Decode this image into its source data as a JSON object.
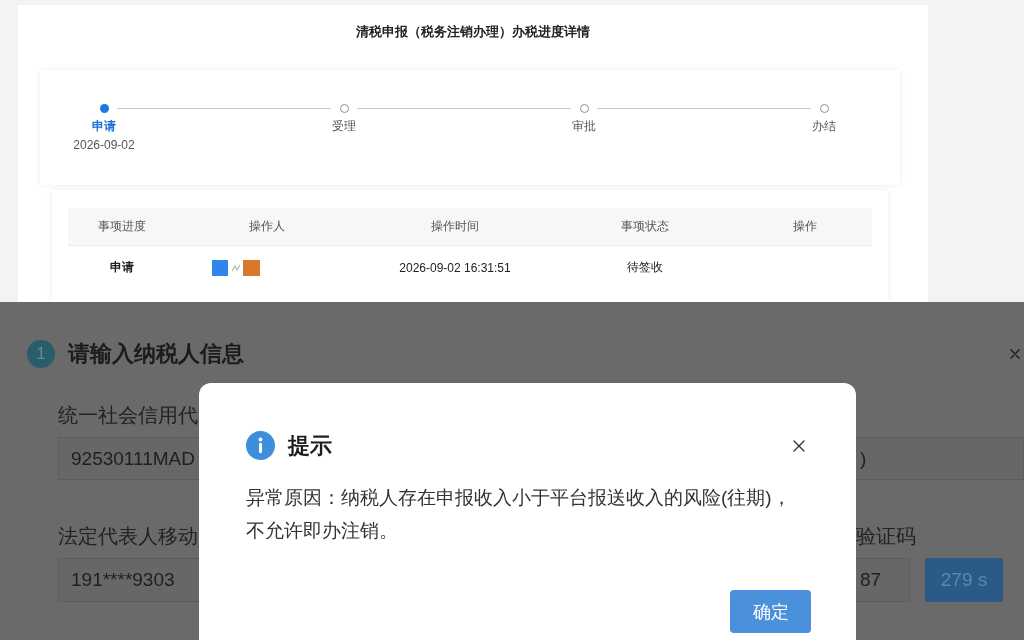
{
  "progress_page": {
    "title": "清税申报（税务注销办理）办税进度详情",
    "steps": [
      {
        "label": "申请",
        "date": "2026-09-02",
        "active": true
      },
      {
        "label": "受理",
        "active": false
      },
      {
        "label": "审批",
        "active": false
      },
      {
        "label": "办结",
        "active": false
      }
    ],
    "table": {
      "columns": [
        "事项进度",
        "操作人",
        "操作时间",
        "事项状态",
        "操作"
      ],
      "rows": [
        {
          "stage": "申请",
          "operator_redacted": true,
          "time": "2026-09-02 16:31:51",
          "status": "待签收"
        }
      ]
    }
  },
  "taxpayer_form": {
    "step_number": "1",
    "title": "请输入纳税人信息",
    "left_fields": [
      {
        "label": "统一社会信用代",
        "value": "92530111MAD"
      },
      {
        "label": "法定代表人移动",
        "value": "191****9303"
      }
    ],
    "right_fields": [
      {
        "value": ")"
      },
      {
        "label": "验证码",
        "value": "87",
        "button": "279 s"
      }
    ]
  },
  "dialog": {
    "title": "提示",
    "message": "异常原因：纳税人存在申报收入小于平台报送收入的风险(往期)，不允许即办注销。",
    "button": "确定"
  }
}
